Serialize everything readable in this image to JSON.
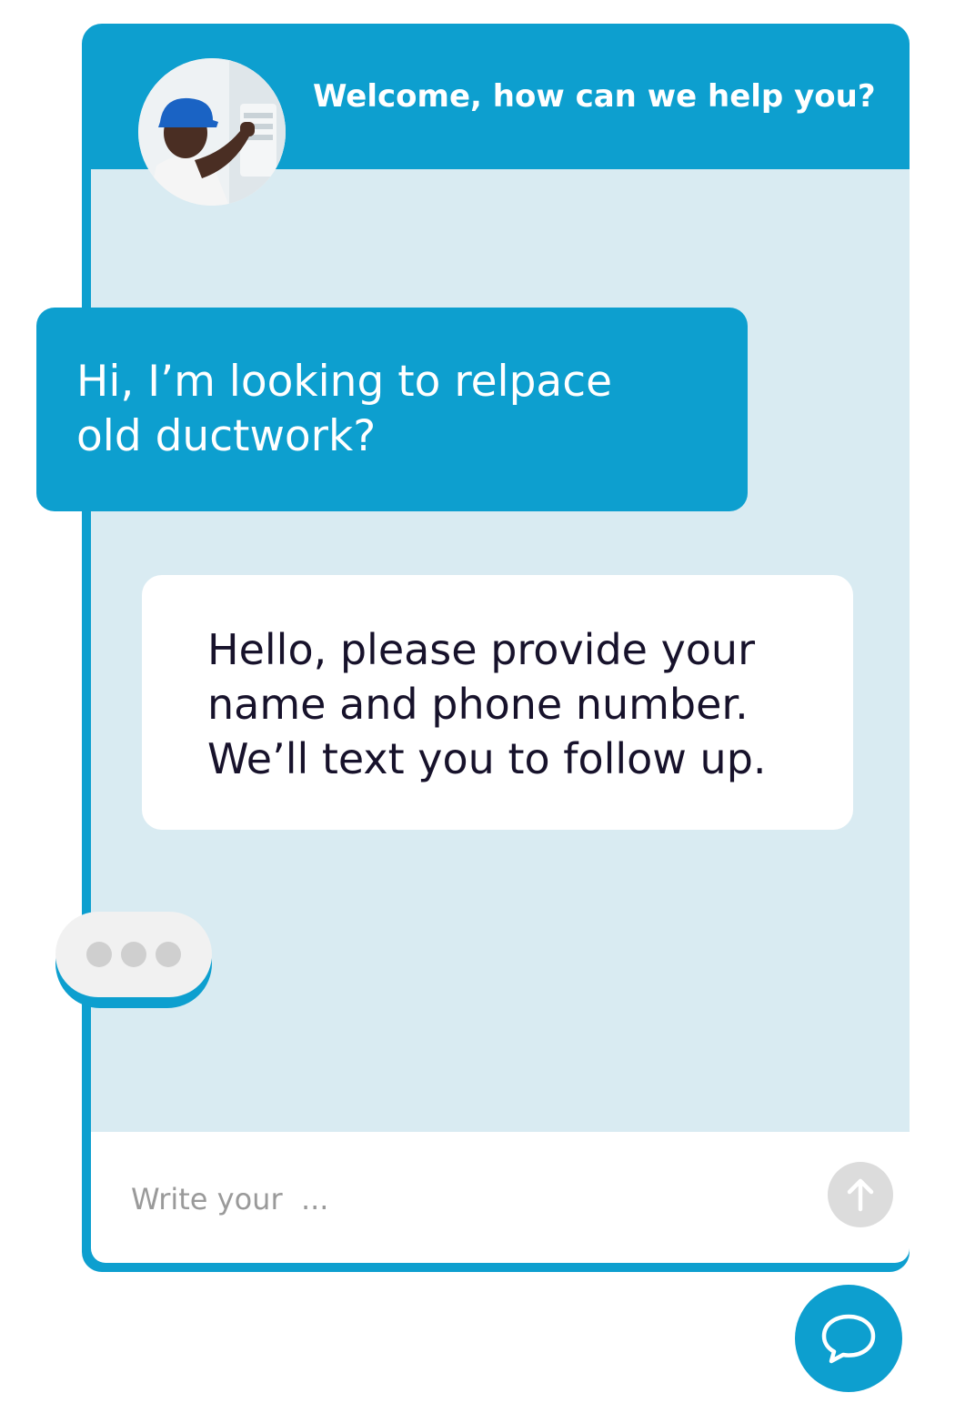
{
  "header": {
    "title": "Welcome, how can we help you?",
    "avatar_icon": "technician-avatar"
  },
  "messages": [
    {
      "sender": "user",
      "lines": [
        "Hi, I’m looking to relpace",
        "old ductwork?"
      ]
    },
    {
      "sender": "agent",
      "lines": [
        "Hello, please provide your",
        "name and phone number.",
        "We’ll text you to follow up."
      ]
    }
  ],
  "typing_indicator": {
    "icon": "typing-dots"
  },
  "input": {
    "placeholder": "Write your  ...",
    "value": ""
  },
  "send_button": {
    "icon": "arrow-up-icon"
  },
  "launcher": {
    "icon": "chat-bubble-icon"
  },
  "colors": {
    "accent": "#0d9fcf",
    "body_background": "#d9ebf2",
    "agent_text": "#17122b",
    "send_button_disabled": "#dcdcdc",
    "typing_pill": "#f1f1f1"
  }
}
